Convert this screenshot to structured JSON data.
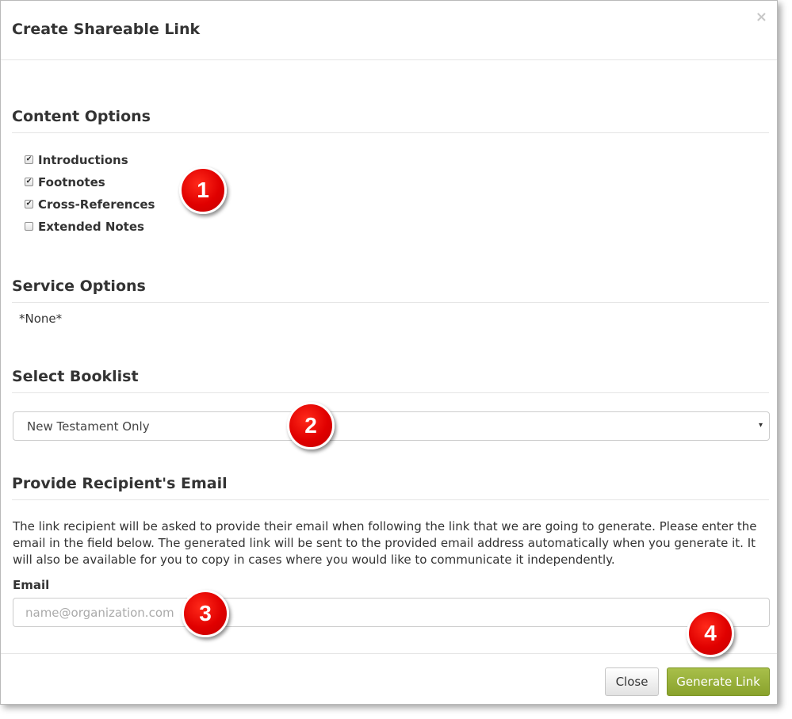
{
  "dialog": {
    "title": "Create Shareable Link",
    "close_icon": "×"
  },
  "content_options": {
    "heading": "Content Options",
    "items": [
      {
        "label": "Introductions",
        "checked": true
      },
      {
        "label": "Footnotes",
        "checked": true
      },
      {
        "label": "Cross-References",
        "checked": true
      },
      {
        "label": "Extended Notes",
        "checked": false
      }
    ]
  },
  "service_options": {
    "heading": "Service Options",
    "value": "*None*"
  },
  "booklist": {
    "heading": "Select Booklist",
    "selected": "New Testament Only",
    "caret": "▾"
  },
  "recipient": {
    "heading": "Provide Recipient's Email",
    "description": "The link recipient will be asked to provide their email when following the link that we are going to generate. Please enter the email in the field below. The generated link will be sent to the provided email address automatically when you generate it. It will also be available for you to copy in cases where you would like to communicate it independently.",
    "email_label": "Email",
    "email_placeholder": "name@organization.com",
    "email_value": ""
  },
  "footer": {
    "close_label": "Close",
    "generate_label": "Generate Link"
  },
  "annotations": [
    "1",
    "2",
    "3",
    "4"
  ],
  "colors": {
    "generate_button": "#97b03a",
    "marker": "#e00000"
  }
}
